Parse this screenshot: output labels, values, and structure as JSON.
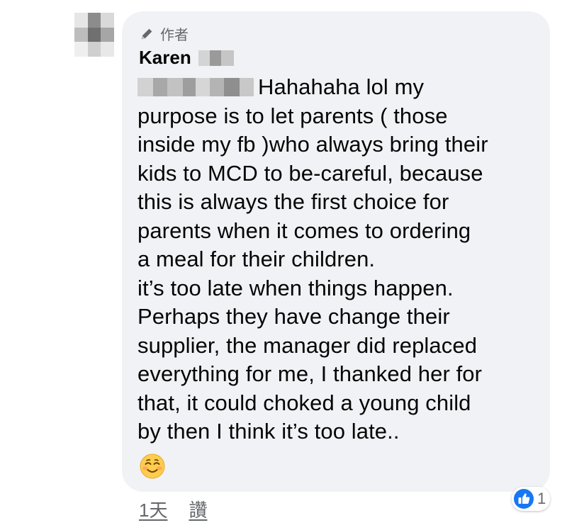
{
  "comment": {
    "author_badge": "作者",
    "author_name": "Karen",
    "lines": [
      "Hahahaha lol my",
      "purpose is to let parents ( those",
      "inside my fb )who always bring their",
      "kids to MCD to be-careful, because",
      "this is always the first choice for",
      "parents when it comes to ordering",
      "a meal for their children.",
      "it’s too late when things happen.",
      "Perhaps they have change their",
      "supplier, the manager did replaced",
      "everything for me, I thanked her for",
      "that, it could choked  a young child",
      "by then I think it’s too late.."
    ],
    "emoji": "smiling-face-with-smiling-eyes",
    "reaction": {
      "type": "like",
      "count": "1",
      "color": "#1877f2"
    },
    "footer": {
      "time": "1天",
      "like_action": "讚"
    }
  },
  "colors": {
    "bubble": "#f0f2f5",
    "text": "#050505",
    "secondary": "#65676b",
    "like_blue": "#1877f2"
  }
}
